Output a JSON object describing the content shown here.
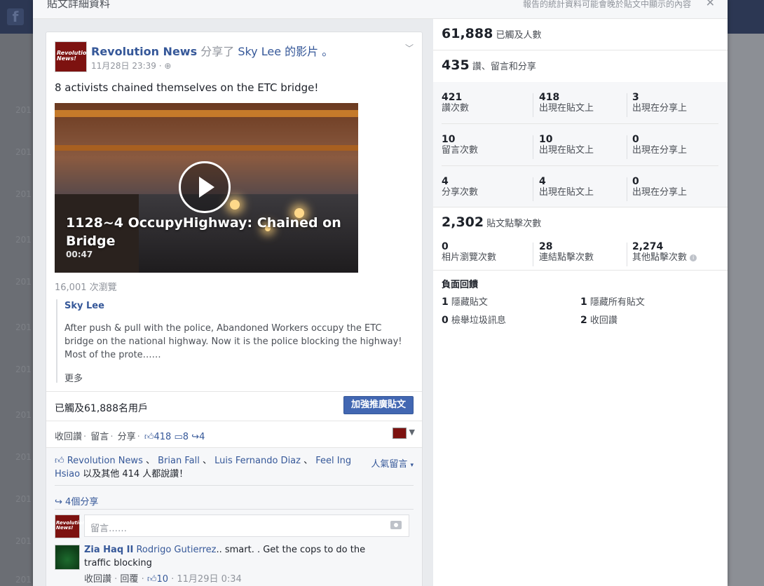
{
  "dialog": {
    "title": "貼文詳細資料",
    "note": "報告的統計資料可能會晚於貼文中顯示的內容",
    "close": "✕"
  },
  "background": {
    "years": [
      "201",
      "201",
      "201",
      "201",
      "201",
      "201",
      "201",
      "201",
      "201",
      "201",
      "201",
      "201"
    ]
  },
  "post": {
    "page_name": "Revolution News",
    "shared_text": "分享了",
    "shared_from": "Sky Lee",
    "shared_suffix": "的影片 。",
    "avatar_text": "Revolution News!",
    "time": "11月28日 23:39 ·",
    "text": "8 activists chained themselves on the ETC bridge!",
    "video": {
      "title": "1128~4 OccupyHighway: Chained on Bridge",
      "duration": "00:47"
    },
    "views": "16,001 次瀏覽",
    "quote": {
      "name": "Sky Lee",
      "text": "After push & pull with the police, Abandoned Workers occupy the ETC bridge on the national highway. Now it is the police blocking the highway! Most of the prote……",
      "more": "更多"
    },
    "reach_text": "已觸及61,888名用戶",
    "boost_label": "加強推廣貼文",
    "actions": {
      "unlike": "收回讚",
      "comment": "留言",
      "share": "分享",
      "likes": "418",
      "comments": "8",
      "shares": "4"
    },
    "likes": {
      "names": [
        "Revolution News",
        "Brian Fall",
        "Luis Fernando Diaz",
        "Feel Ing Hsiao"
      ],
      "sep": "、",
      "suffix": "以及其他 414 人都說讚！",
      "top_comments": "人氣留言"
    },
    "share_count": "4個分享",
    "comment_placeholder": "留言……",
    "comment": {
      "author": "Zia Haq II",
      "mention": "Rodrigo Gutierrez",
      "text": ".. smart. . Get the cops to do the traffic blocking",
      "unlike": "收回讚",
      "reply": "回覆",
      "likes": "10",
      "time": "11月29日 0:34"
    }
  },
  "stats": {
    "reach": {
      "value": "61,888",
      "label": "已觸及人數"
    },
    "engagement": {
      "value": "435",
      "label": "讚、留言和分享"
    },
    "grid": [
      {
        "n": "421",
        "l": "讚次數"
      },
      {
        "n": "418",
        "l": "出現在貼文上"
      },
      {
        "n": "3",
        "l": "出現在分享上"
      },
      {
        "n": "10",
        "l": "留言次數"
      },
      {
        "n": "10",
        "l": "出現在貼文上"
      },
      {
        "n": "0",
        "l": "出現在分享上"
      },
      {
        "n": "4",
        "l": "分享次數"
      },
      {
        "n": "4",
        "l": "出現在貼文上"
      },
      {
        "n": "0",
        "l": "出現在分享上"
      }
    ],
    "clicks": {
      "value": "2,302",
      "label": "貼文點擊次數"
    },
    "click_breakdown": [
      {
        "n": "0",
        "l": "相片瀏覽次數"
      },
      {
        "n": "28",
        "l": "連結點擊次數"
      },
      {
        "n": "2,274",
        "l": "其他點擊次數"
      }
    ],
    "negative": {
      "title": "負面回饋",
      "items": [
        {
          "n": "1",
          "l": "隱藏貼文"
        },
        {
          "n": "1",
          "l": "隱藏所有貼文"
        },
        {
          "n": "0",
          "l": "檢舉垃圾訊息"
        },
        {
          "n": "2",
          "l": "收回讚"
        }
      ]
    }
  }
}
